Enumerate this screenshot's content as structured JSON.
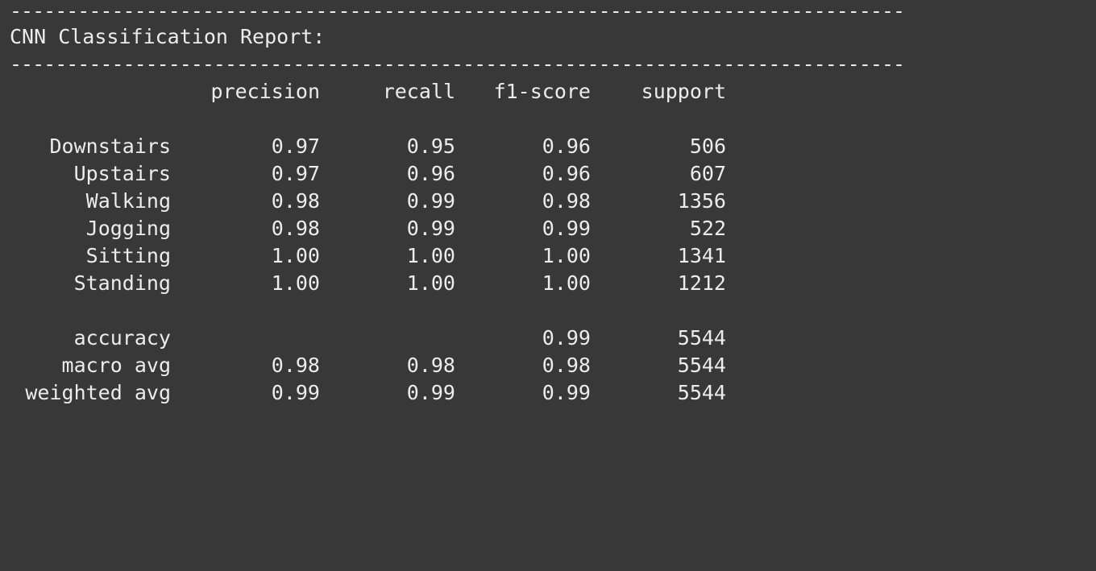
{
  "report": {
    "rule": "-------------------------------------------------------------------------------",
    "title": "CNN Classification Report:",
    "headers": {
      "precision": "precision",
      "recall": "recall",
      "f1": "f1-score",
      "support": "support"
    },
    "rows": [
      {
        "label": "Downstairs",
        "precision": "0.97",
        "recall": "0.95",
        "f1": "0.96",
        "support": "506"
      },
      {
        "label": "Upstairs",
        "precision": "0.97",
        "recall": "0.96",
        "f1": "0.96",
        "support": "607"
      },
      {
        "label": "Walking",
        "precision": "0.98",
        "recall": "0.99",
        "f1": "0.98",
        "support": "1356"
      },
      {
        "label": "Jogging",
        "precision": "0.98",
        "recall": "0.99",
        "f1": "0.99",
        "support": "522"
      },
      {
        "label": "Sitting",
        "precision": "1.00",
        "recall": "1.00",
        "f1": "1.00",
        "support": "1341"
      },
      {
        "label": "Standing",
        "precision": "1.00",
        "recall": "1.00",
        "f1": "1.00",
        "support": "1212"
      }
    ],
    "summary": [
      {
        "label": "accuracy",
        "precision": "",
        "recall": "",
        "f1": "0.99",
        "support": "5544"
      },
      {
        "label": "macro avg",
        "precision": "0.98",
        "recall": "0.98",
        "f1": "0.98",
        "support": "5544"
      },
      {
        "label": "weighted avg",
        "precision": "0.99",
        "recall": "0.99",
        "f1": "0.99",
        "support": "5544"
      }
    ]
  }
}
